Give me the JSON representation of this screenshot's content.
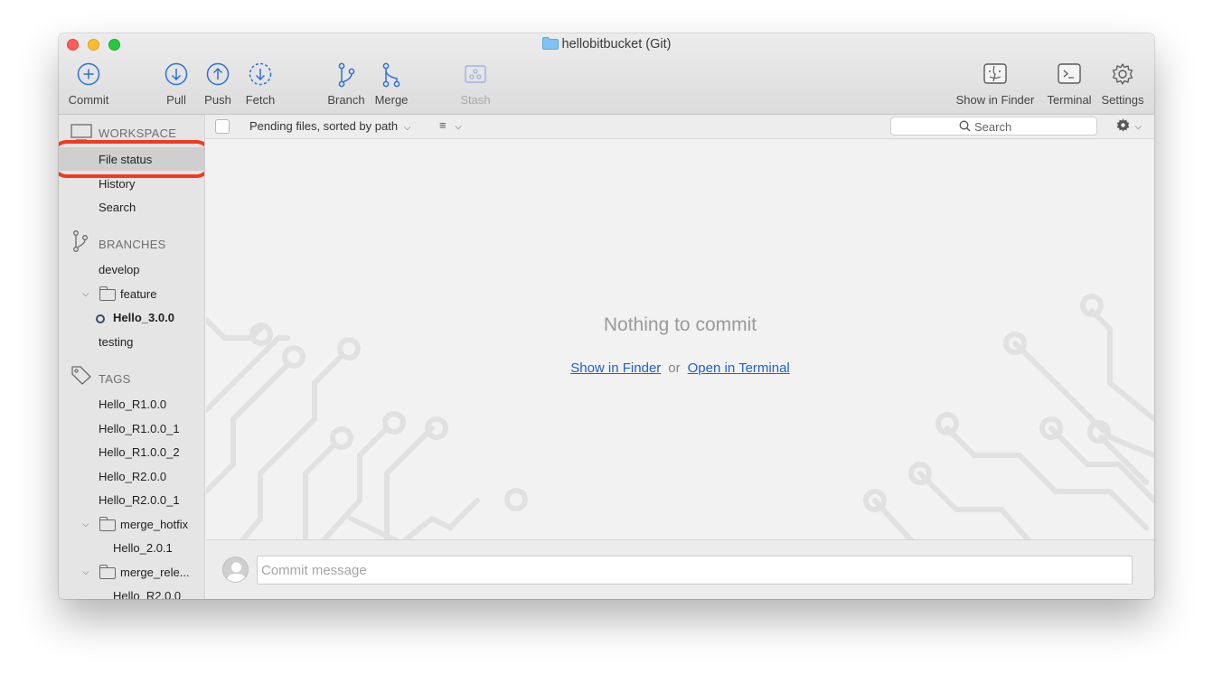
{
  "window": {
    "title": "hellobitbucket (Git)",
    "icons": [
      "folder-icon"
    ]
  },
  "toolbar": {
    "commit": "Commit",
    "pull": "Pull",
    "push": "Push",
    "fetch": "Fetch",
    "branch": "Branch",
    "merge": "Merge",
    "stash": "Stash",
    "show_in_finder": "Show in Finder",
    "terminal": "Terminal",
    "settings": "Settings"
  },
  "sidebar": {
    "workspace": {
      "header": "WORKSPACE",
      "items": [
        "File status",
        "History",
        "Search"
      ],
      "selected": "File status"
    },
    "branches": {
      "header": "BRANCHES",
      "items": {
        "develop": "develop",
        "feature_folder": "feature",
        "feature_child": "Hello_3.0.0",
        "testing": "testing"
      },
      "current": "Hello_3.0.0"
    },
    "tags": {
      "header": "TAGS",
      "items": [
        "Hello_R1.0.0",
        "Hello_R1.0.0_1",
        "Hello_R1.0.0_2",
        "Hello_R2.0.0",
        "Hello_R2.0.0_1"
      ],
      "folders": {
        "merge_hotfix": "merge_hotfix",
        "merge_hotfix_child": "Hello_2.0.1",
        "merge_release": "merge_rele...",
        "merge_release_child": "Hello_R2.0.0"
      }
    }
  },
  "filterbar": {
    "pending_label": "Pending files, sorted by path",
    "search_placeholder": "Search"
  },
  "main": {
    "empty_title": "Nothing to commit",
    "show_in_finder_link": "Show in Finder",
    "or": "or",
    "open_terminal_link": "Open in Terminal"
  },
  "commit": {
    "placeholder": "Commit message",
    "value": ""
  },
  "colors": {
    "accent_link": "#1f62c9",
    "toolbar_icon": "#2f6fd6",
    "highlight_ring": "#f33a20",
    "sidebar_bg": "#e5e5e5"
  }
}
